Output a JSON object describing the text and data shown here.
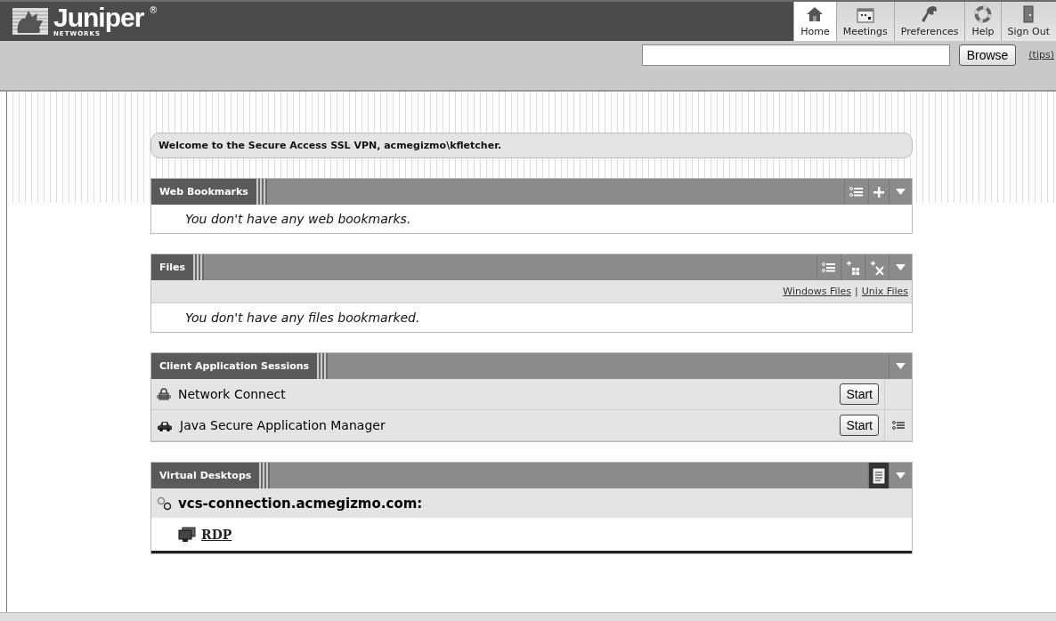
{
  "logo": {
    "name": "Juniper",
    "sub": "NETWORKS",
    "mark": "®"
  },
  "nav": [
    {
      "label": "Home",
      "selected": true
    },
    {
      "label": "Meetings",
      "selected": false
    },
    {
      "label": "Preferences",
      "selected": false
    },
    {
      "label": "Help",
      "selected": false
    },
    {
      "label": "Sign Out",
      "selected": false
    }
  ],
  "toolbar": {
    "browse": "Browse",
    "tips": "(tips)"
  },
  "welcome": "Welcome to the Secure Access SSL VPN, acmegizmo\\kfletcher.",
  "panels": [
    {
      "kind": "bookmarks",
      "title": "Web Bookmarks",
      "message": "You don't have any web bookmarks."
    },
    {
      "kind": "files",
      "title": "Files",
      "links": [
        "Windows Files",
        "Unix Files"
      ],
      "separator": "|",
      "message": "You don't have any files bookmarked."
    },
    {
      "kind": "sessions",
      "title": "Client Application Sessions",
      "rows": [
        {
          "label": "Network Connect",
          "button": "Start",
          "options": false
        },
        {
          "label": "Java Secure Application Manager",
          "button": "Start",
          "options": true
        }
      ]
    },
    {
      "kind": "desktops",
      "title": "Virtual Desktops",
      "host": "vcs-connection.acmegizmo.com:",
      "link": "RDP"
    }
  ]
}
